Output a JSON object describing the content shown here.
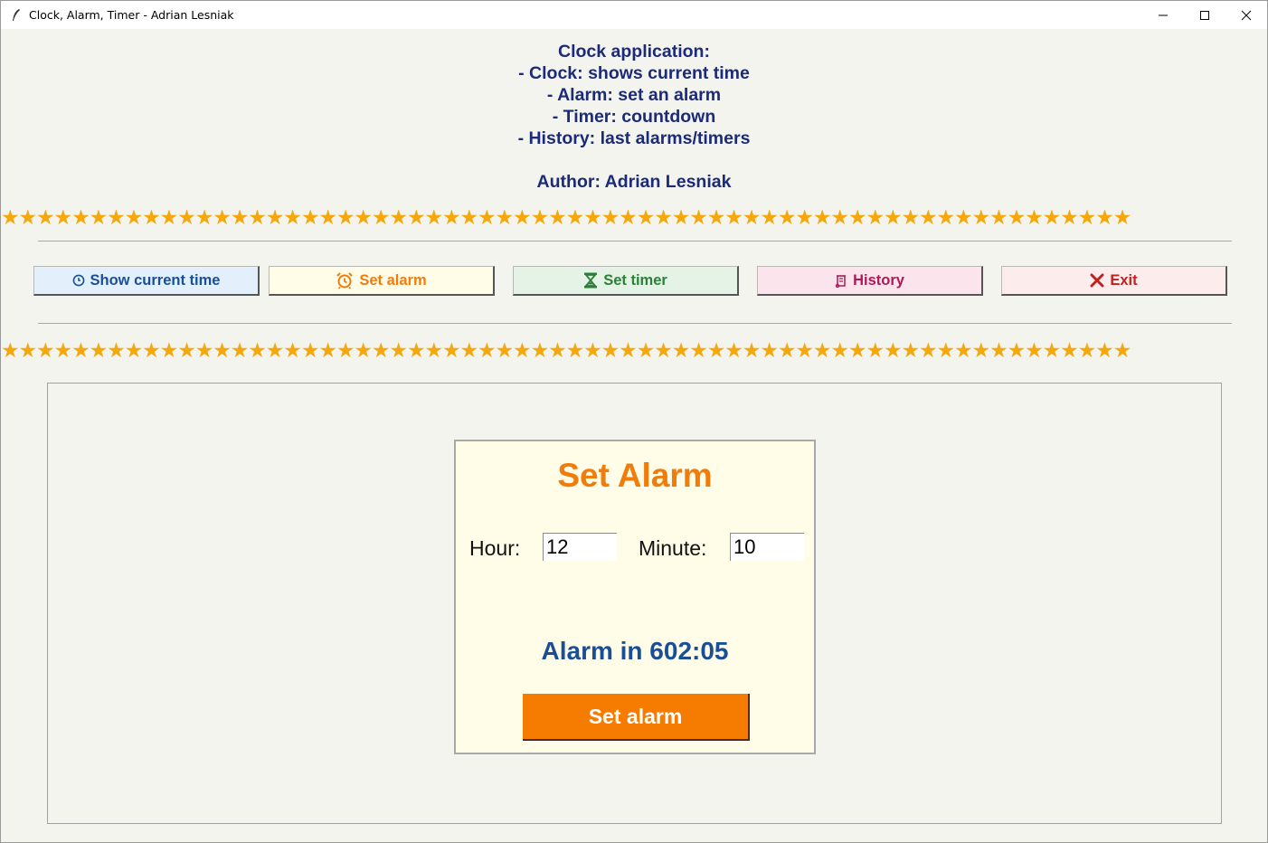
{
  "window": {
    "title": "Clock, Alarm, Timer - Adrian Lesniak",
    "controls": [
      "minimize",
      "maximize",
      "close"
    ]
  },
  "intro": {
    "lines": [
      "Clock application:",
      "- Clock: shows current time",
      "- Alarm: set an alarm",
      "- Timer: countdown",
      "- History: last alarms/timers"
    ],
    "author": "Author: Adrian Lesniak"
  },
  "decor": {
    "stars": "★★★★★★★★★★★★★★★★★★★★★★★★★★★★★★★★★★★★★★★★★★★★★★★★★★★★★★★★★★★★★★★★"
  },
  "nav": {
    "clock": {
      "label": "Show current time",
      "icon": "clock-icon",
      "color": "#1a4f97",
      "bg": "#e3f0fc"
    },
    "alarm": {
      "label": "Set alarm",
      "icon": "alarm-clock-icon",
      "color": "#f07c0c",
      "bg": "#fffde8"
    },
    "timer": {
      "label": "Set timer",
      "icon": "hourglass-icon",
      "color": "#2d7f39",
      "bg": "#e5f3e6"
    },
    "history": {
      "label": "History",
      "icon": "scroll-icon",
      "color": "#ad1a56",
      "bg": "#fce4ec"
    },
    "exit": {
      "label": "Exit",
      "icon": "x-icon",
      "color": "#c02020",
      "bg": "#fdecec"
    }
  },
  "alarm_panel": {
    "title": "Set Alarm",
    "hour_label": "Hour:",
    "hour_value": "12",
    "minute_label": "Minute:",
    "minute_value": "10",
    "countdown": "Alarm in 602:05",
    "button_label": "Set alarm"
  },
  "colors": {
    "accent_orange": "#f57c00",
    "title_navy": "#1c2a7a",
    "star_gold": "#f5a80d",
    "countdown_blue": "#1a4f97"
  }
}
